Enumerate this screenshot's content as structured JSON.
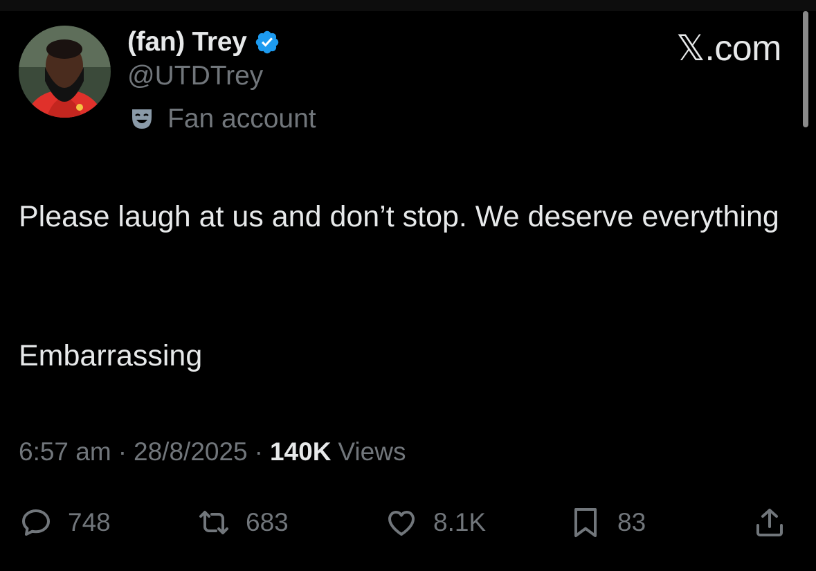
{
  "brand": "𝕏.com",
  "profile": {
    "display_name": "(fan) Trey",
    "handle": "@UTDTrey",
    "label": "Fan account",
    "verified_icon": "verified-badge-icon",
    "label_icon": "theater-mask-icon",
    "accent_color": "#1d9bf0"
  },
  "tweet": {
    "line1": "Please laugh at us and don’t stop. We deserve everything",
    "line2": "Embarrassing"
  },
  "meta": {
    "time": "6:57 am",
    "date": "28/8/2025",
    "separator": "·",
    "views_count": "140K",
    "views_label": "Views"
  },
  "actions": {
    "replies": "748",
    "reposts": "683",
    "likes": "8.1K",
    "bookmarks": "83"
  }
}
